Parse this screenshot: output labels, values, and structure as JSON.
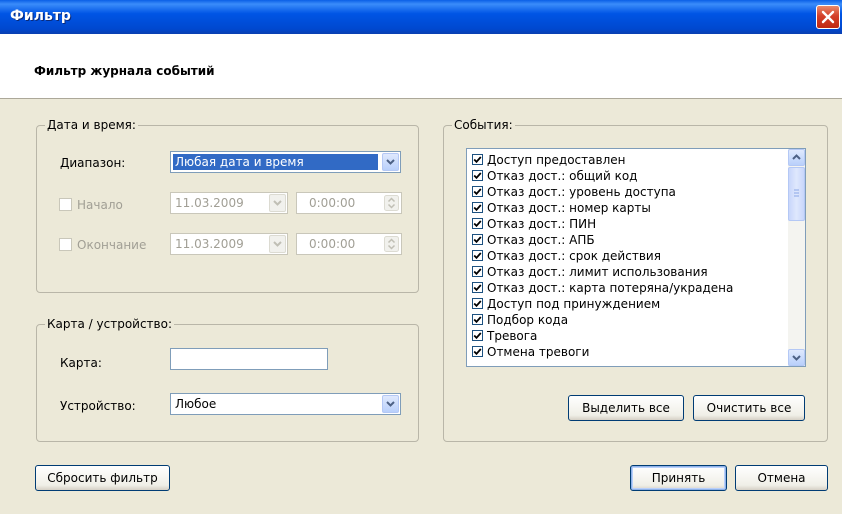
{
  "window": {
    "title": "Фильтр"
  },
  "header": {
    "title": "Фильтр журнала событий"
  },
  "datetime": {
    "legend": "Дата и время:",
    "range_label": "Диапазон:",
    "range_value": "Любая дата и время",
    "start_label": "Начало",
    "start_date": "11.03.2009",
    "start_time": "0:00:00",
    "end_label": "Окончание",
    "end_date": "11.03.2009",
    "end_time": "0:00:00"
  },
  "card_device": {
    "legend": "Карта / устройство:",
    "card_label": "Карта:",
    "card_value": "",
    "device_label": "Устройство:",
    "device_value": "Любое"
  },
  "events": {
    "legend": "События:",
    "items": [
      {
        "label": "Доступ предоставлен",
        "checked": true
      },
      {
        "label": "Отказ дост.: общий код",
        "checked": true
      },
      {
        "label": "Отказ дост.: уровень доступа",
        "checked": true
      },
      {
        "label": "Отказ дост.: номер карты",
        "checked": true
      },
      {
        "label": "Отказ дост.: ПИН",
        "checked": true
      },
      {
        "label": "Отказ дост.: АПБ",
        "checked": true
      },
      {
        "label": "Отказ дост.: срок действия",
        "checked": true
      },
      {
        "label": "Отказ дост.: лимит использования",
        "checked": true
      },
      {
        "label": "Отказ дост.: карта потеряна/украдена",
        "checked": true
      },
      {
        "label": "Доступ под принуждением",
        "checked": true
      },
      {
        "label": "Подбор кода",
        "checked": true
      },
      {
        "label": "Тревога",
        "checked": true
      },
      {
        "label": "Отмена тревоги",
        "checked": true
      }
    ],
    "select_all": "Выделить все",
    "clear_all": "Очистить все"
  },
  "buttons": {
    "reset": "Сбросить фильтр",
    "accept": "Принять",
    "cancel": "Отмена"
  },
  "colors": {
    "titlebar": "#0055e5",
    "selection": "#316ac5",
    "dialog": "#ece9d8"
  }
}
